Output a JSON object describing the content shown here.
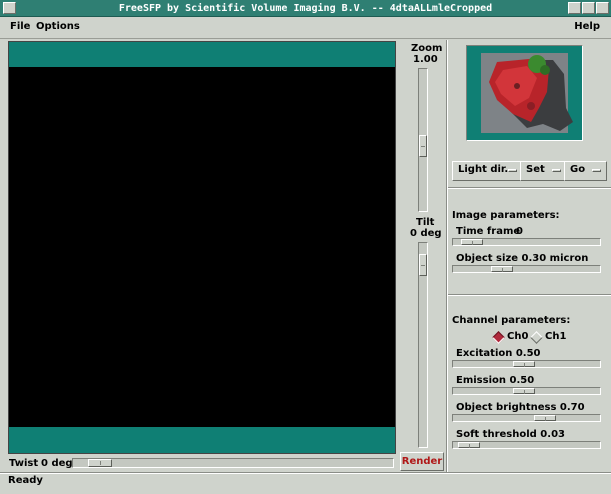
{
  "window": {
    "title": "FreeSFP by Scientific Volume Imaging B.V. -- 4dtaALLmleCropped"
  },
  "menubar": {
    "file": "File",
    "options": "Options",
    "help": "Help"
  },
  "zoom": {
    "label": "Zoom",
    "value": "1.00",
    "position": 0.55
  },
  "tilt": {
    "label": "Tilt",
    "value": "0 deg",
    "position": 0.06
  },
  "twist": {
    "label": "Twist",
    "value": "0 deg",
    "position": 0.05
  },
  "controls": {
    "light_dir": "Light dir.",
    "set": "Set",
    "go": "Go",
    "render": "Render"
  },
  "image_params": {
    "heading": "Image parameters:",
    "time_frame_label": "Time frame",
    "time_frame_value": "0",
    "time_frame_position": 0.06,
    "object_size": "Object size 0.30 micron",
    "object_size_position": 0.3
  },
  "channel_params": {
    "heading": "Channel parameters:",
    "ch0": "Ch0",
    "ch1": "Ch1",
    "selected": "Ch0",
    "excitation": "Excitation 0.50",
    "excitation_position": 0.48,
    "emission": "Emission 0.50",
    "emission_position": 0.48,
    "brightness": "Object brightness 0.70",
    "brightness_position": 0.65,
    "soft_threshold": "Soft threshold 0.03",
    "soft_threshold_position": 0.04
  },
  "status": {
    "text": "Ready"
  },
  "colors": {
    "title_bar": "#2f7f73",
    "viewport_band": "#0f7f74",
    "render_text": "#b01818",
    "radio_selected": "#b02a3c"
  }
}
